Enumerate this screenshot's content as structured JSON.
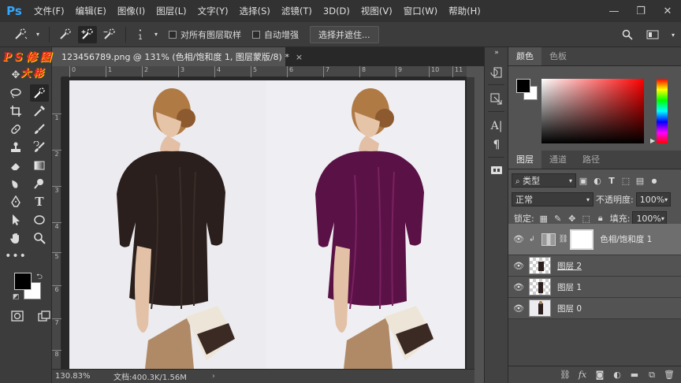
{
  "app": {
    "logo": "Ps"
  },
  "menu": [
    "文件(F)",
    "编辑(E)",
    "图像(I)",
    "图层(L)",
    "文字(Y)",
    "选择(S)",
    "滤镜(T)",
    "3D(D)",
    "视图(V)",
    "窗口(W)",
    "帮助(H)"
  ],
  "options": {
    "brush_size": "1",
    "sample_all": "对所有图层取样",
    "auto_enhance": "自动增强",
    "select_mask": "选择并遮住..."
  },
  "watermark": {
    "line1": "PS修图",
    "line2": "大彬"
  },
  "document": {
    "tab_title": "123456789.png @ 131% (色相/饱和度 1, 图层蒙版/8) *",
    "close": "×"
  },
  "ruler_h": [
    "0",
    "1",
    "2",
    "3",
    "4",
    "5",
    "6",
    "7",
    "8",
    "9",
    "10",
    "11"
  ],
  "ruler_v": [
    "1",
    "2",
    "3",
    "4",
    "5",
    "6",
    "7",
    "8"
  ],
  "status": {
    "zoom": "130.83%",
    "doc": "文档:400.3K/1.56M"
  },
  "color_panel": {
    "tabs": [
      "颜色",
      "色板"
    ]
  },
  "layers_panel": {
    "tabs": [
      "图层",
      "通道",
      "路径"
    ],
    "kind": "类型",
    "blend": "正常",
    "opacity_label": "不透明度:",
    "opacity": "100%",
    "lock_label": "锁定:",
    "fill_label": "填充:",
    "fill": "100%",
    "layers": [
      {
        "name": "色相/饱和度 1"
      },
      {
        "name": "图层 2"
      },
      {
        "name": "图层 1"
      },
      {
        "name": "图层 0"
      }
    ]
  },
  "colors": {
    "accent": "#31a8ff",
    "shirt_left": "#2a1f1c",
    "shirt_right": "#5a1246"
  }
}
